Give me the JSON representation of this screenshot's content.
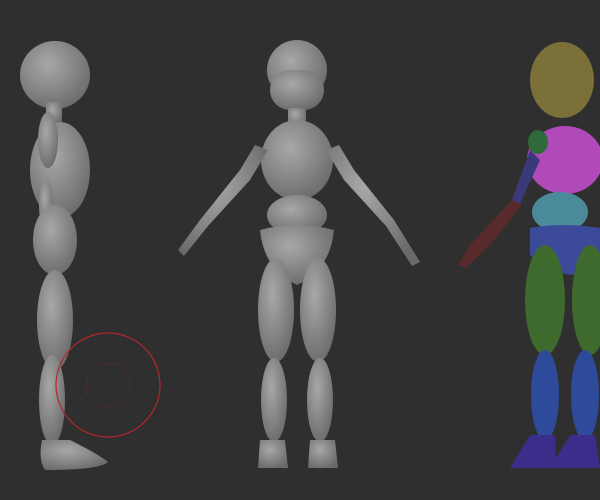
{
  "viewport": {
    "background": "#2f2f2f",
    "model_color": "#8c8c8c",
    "brush_cursor_color": "#b0282c"
  },
  "polygroups": {
    "head": "#7a7038",
    "chest": "#b04ab8",
    "belly": "#4a8a9a",
    "pelvis": "#3c4a9a",
    "legs": "#3e6a2e",
    "shins": "#2e4a9a",
    "feet": "#3a2e8a",
    "arm_upper": "#3a3a7a",
    "arm_lower": "#5a2a2a",
    "shoulder": "#2e6a3a"
  }
}
